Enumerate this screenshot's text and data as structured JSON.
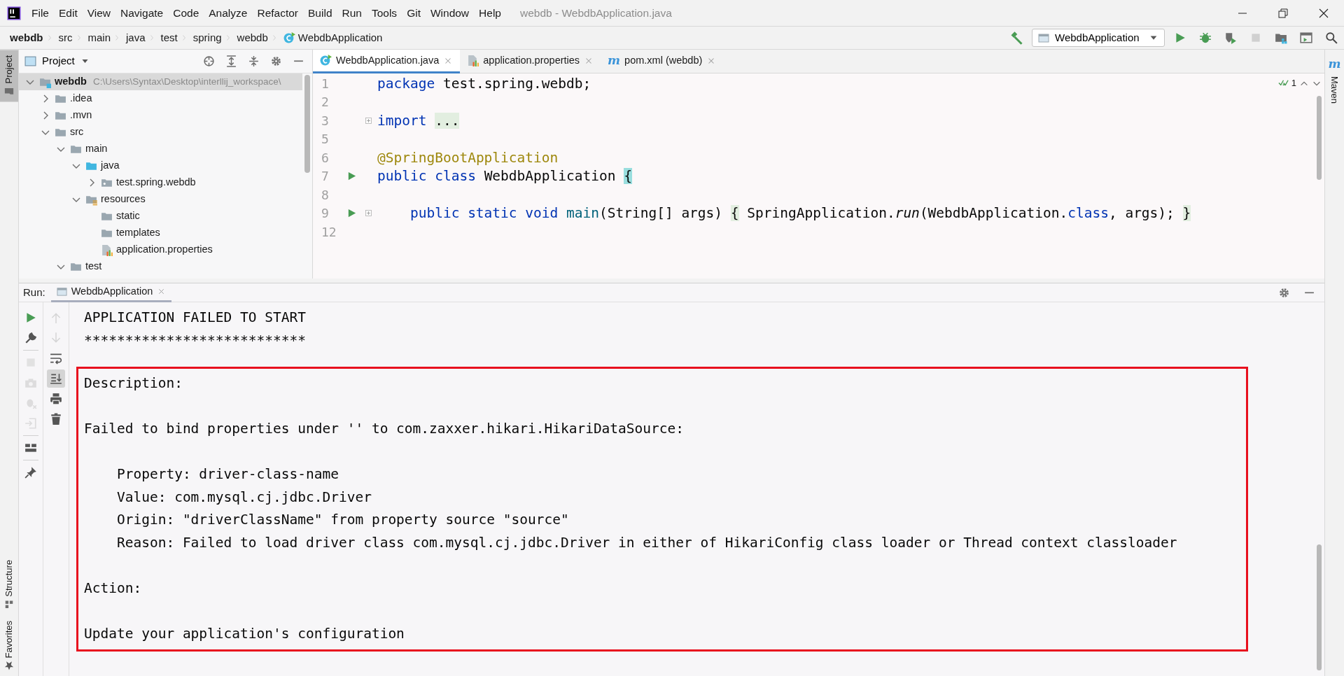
{
  "menu": {
    "items": [
      "File",
      "Edit",
      "View",
      "Navigate",
      "Code",
      "Analyze",
      "Refactor",
      "Build",
      "Run",
      "Tools",
      "Git",
      "Window",
      "Help"
    ],
    "title": "webdb - WebdbApplication.java"
  },
  "breadcrumb": [
    {
      "label": "webdb",
      "kind": "module"
    },
    {
      "label": "src",
      "kind": "folder"
    },
    {
      "label": "main",
      "kind": "folder"
    },
    {
      "label": "java",
      "kind": "folder"
    },
    {
      "label": "test",
      "kind": "folder"
    },
    {
      "label": "spring",
      "kind": "folder"
    },
    {
      "label": "webdb",
      "kind": "folder"
    },
    {
      "label": "WebdbApplication",
      "kind": "class"
    }
  ],
  "toolbar": {
    "run_config": "WebdbApplication",
    "stop_disabled": true
  },
  "left_strip": [
    {
      "label": "Project",
      "kind": "project",
      "selected": true
    },
    {
      "label": "Structure",
      "kind": "structure",
      "selected": false
    },
    {
      "label": "Favorites",
      "kind": "favorites",
      "selected": false
    }
  ],
  "right_strip": [
    {
      "label": "Maven",
      "glyph": "m"
    }
  ],
  "project_panel": {
    "title": "Project",
    "tree": [
      {
        "label": "webdb",
        "kind": "module",
        "path": "C:\\Users\\Syntax\\Desktop\\interllij_workspace\\",
        "expanded": true,
        "selected": true,
        "children": [
          {
            "label": ".idea",
            "kind": "folder",
            "expanded": false,
            "selected": false
          },
          {
            "label": ".mvn",
            "kind": "folder",
            "expanded": false,
            "selected": false
          },
          {
            "label": "src",
            "kind": "folder",
            "expanded": true,
            "selected": false,
            "children": [
              {
                "label": "main",
                "kind": "folder",
                "expanded": true,
                "selected": false,
                "children": [
                  {
                    "label": "java",
                    "kind": "source",
                    "expanded": true,
                    "selected": false,
                    "children": [
                      {
                        "label": "test.spring.webdb",
                        "kind": "package",
                        "expanded": false,
                        "selected": false
                      }
                    ]
                  },
                  {
                    "label": "resources",
                    "kind": "resources",
                    "expanded": true,
                    "selected": false,
                    "children": [
                      {
                        "label": "static",
                        "kind": "folder",
                        "selected": false
                      },
                      {
                        "label": "templates",
                        "kind": "folder",
                        "selected": false
                      },
                      {
                        "label": "application.properties",
                        "kind": "properties",
                        "selected": false
                      }
                    ]
                  }
                ]
              },
              {
                "label": "test",
                "kind": "folder",
                "expanded": true,
                "selected": false
              }
            ]
          }
        ]
      }
    ]
  },
  "editor": {
    "tabs": [
      {
        "label": "WebdbApplication.java",
        "kind": "class",
        "selected": true
      },
      {
        "label": "application.properties",
        "kind": "properties",
        "selected": false
      },
      {
        "label": "pom.xml (webdb)",
        "kind": "maven",
        "glyph": "m",
        "selected": false
      }
    ],
    "inspection_count": "1",
    "lines": [
      {
        "number": "1",
        "segments": [
          {
            "text": "package",
            "kind": "keyword"
          },
          {
            "text": " test.spring.webdb;",
            "kind": "plain"
          }
        ]
      },
      {
        "number": "2"
      },
      {
        "number": "3",
        "fold": true,
        "segments": [
          {
            "text": "import",
            "kind": "keyword"
          },
          {
            "text": "...",
            "kind": "folded"
          }
        ]
      },
      {
        "number": "5"
      },
      {
        "number": "6",
        "segments": [
          {
            "text": "@SpringBootApplication",
            "kind": "annotation"
          }
        ]
      },
      {
        "number": "7",
        "run": true,
        "segments": [
          {
            "text": "public class",
            "kind": "keyword"
          },
          {
            "text": " WebdbApplication ",
            "kind": "plain"
          },
          {
            "text": "{",
            "kind": "brace"
          }
        ]
      },
      {
        "number": "8"
      },
      {
        "number": "9",
        "run": true,
        "fold": true,
        "indented": true,
        "segments": [
          {
            "text": "public static void",
            "kind": "keyword"
          },
          {
            "text": "main",
            "kind": "method"
          },
          {
            "text": "(String[] args) ",
            "kind": "plain"
          },
          {
            "text": "{",
            "kind": "folded"
          },
          {
            "text": " SpringApplication.",
            "kind": "plain"
          },
          {
            "text": "run",
            "kind": "static"
          },
          {
            "text": "(WebdbApplication.",
            "kind": "plain"
          },
          {
            "text": "class",
            "kind": "keyword"
          },
          {
            "text": ", args);",
            "kind": "plain"
          },
          {
            "text": "}",
            "kind": "folded"
          }
        ]
      },
      {
        "number": "12"
      }
    ]
  },
  "run_panel": {
    "label": "Run:",
    "tabs": [
      {
        "label": "WebdbApplication",
        "selected": true
      }
    ],
    "toolbar_primary": [
      [
        {
          "kind": "run",
          "disabled": false
        },
        {
          "kind": "wrench",
          "disabled": false
        }
      ],
      [
        {
          "kind": "stop",
          "disabled": true
        },
        {
          "kind": "camera",
          "disabled": true
        },
        {
          "kind": "bug",
          "disabled": true
        },
        {
          "kind": "exit",
          "disabled": true
        }
      ],
      [
        {
          "kind": "layout",
          "disabled": false
        }
      ],
      [
        {
          "kind": "pin",
          "disabled": false
        }
      ]
    ],
    "toolbar_secondary": [
      {
        "kind": "up",
        "disabled": true,
        "selected": false
      },
      {
        "kind": "down",
        "disabled": true,
        "selected": false
      },
      {
        "kind": "wrap",
        "disabled": false,
        "selected": false
      },
      {
        "kind": "scroll-end",
        "disabled": false,
        "selected": true
      },
      {
        "kind": "print",
        "disabled": false,
        "selected": false
      },
      {
        "kind": "trash",
        "disabled": false,
        "selected": false
      }
    ],
    "console": {
      "lines": [
        "APPLICATION FAILED TO START",
        "***************************"
      ],
      "highlighted_groups": [
        [
          "Description:"
        ],
        [
          "Failed to bind properties under '' to com.zaxxer.hikari.HikariDataSource:"
        ],
        [
          "    Property: driver-class-name",
          "    Value: com.mysql.cj.jdbc.Driver",
          "    Origin: \"driverClassName\" from property source \"source\"",
          "    Reason: Failed to load driver class com.mysql.cj.jdbc.Driver in either of HikariConfig class loader or Thread context classloader"
        ],
        [
          "Action:"
        ],
        [
          "Update your application's configuration"
        ]
      ]
    }
  }
}
